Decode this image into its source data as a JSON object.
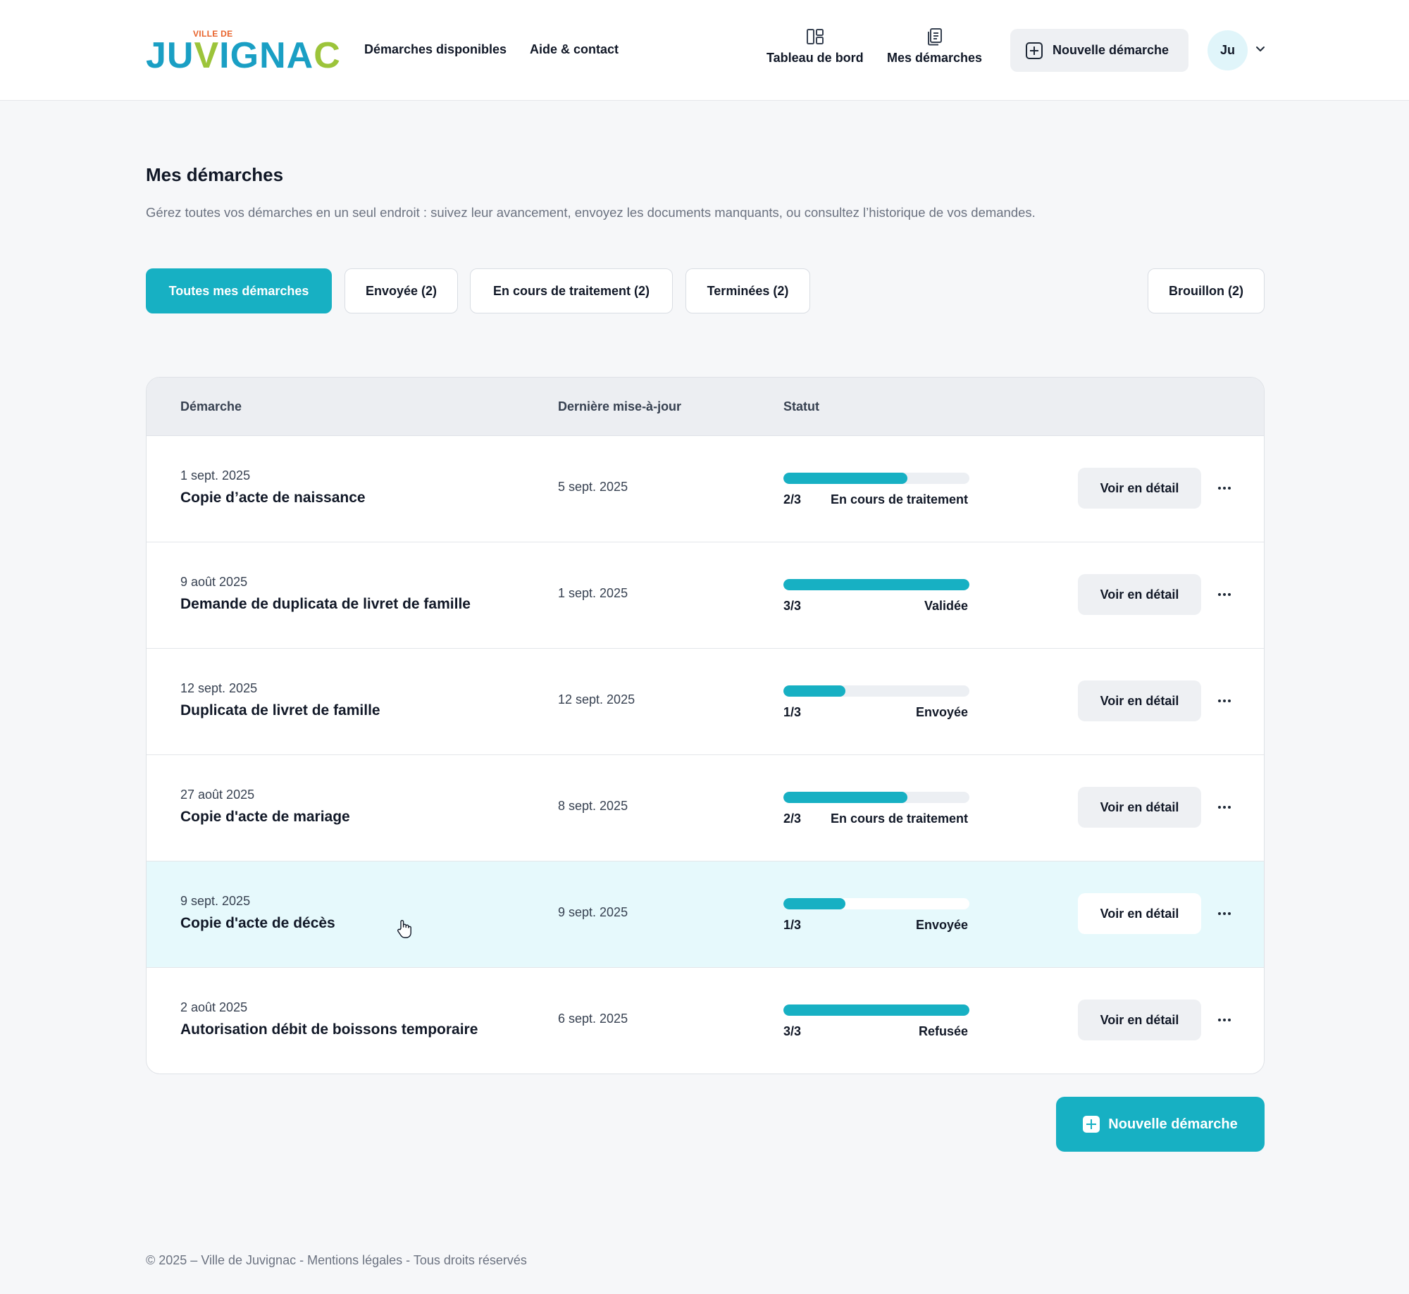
{
  "brand": {
    "small": "VILLE DE",
    "letters": [
      "J",
      "U",
      "V",
      "I",
      "G",
      "N",
      "A",
      "C"
    ],
    "colors": [
      "#1a9fc4",
      "#1a9fc4",
      "#9cc43a",
      "#1a9fc4",
      "#1a9fc4",
      "#1a9fc4",
      "#1a9fc4",
      "#9cc43a"
    ],
    "small_color": "#e8632b"
  },
  "nav": {
    "links": [
      "Démarches disponibles",
      "Aide & contact"
    ],
    "dashboard_label": "Tableau de bord",
    "dashboard_icon": "dashboard-icon",
    "mes_demarches_label": "Mes démarches",
    "mes_demarches_icon": "documents-icon",
    "new_button": "Nouvelle démarche",
    "avatar": "Ju"
  },
  "page": {
    "title": "Mes démarches",
    "subtitle": "Gérez toutes vos démarches en un seul endroit : suivez leur avancement, envoyez les documents manquants, ou consultez l’historique de vos demandes."
  },
  "tabs": [
    {
      "label": "Toutes mes démarches",
      "active": true
    },
    {
      "label": "Envoyée (2)",
      "active": false
    },
    {
      "label": "En cours de traitement (2)",
      "active": false
    },
    {
      "label": "Terminées (2)",
      "active": false
    },
    {
      "label": "Brouillon (2)",
      "active": false
    }
  ],
  "table": {
    "headers": [
      "Démarche",
      "Dernière mise-à-jour",
      "Statut"
    ],
    "detail_label": "Voir en détail",
    "rows": [
      {
        "date": "1 sept. 2025",
        "title": "Copie d’acte de naissance",
        "updated": "5 sept. 2025",
        "step": "2/3",
        "progress": 0.667,
        "status": "En cours de traitement",
        "highlighted": false
      },
      {
        "date": "9 août 2025",
        "title": "Demande de duplicata de livret de famille",
        "updated": "1 sept. 2025",
        "step": "3/3",
        "progress": 1.0,
        "status": "Validée",
        "highlighted": false
      },
      {
        "date": "12 sept. 2025",
        "title": "Duplicata de livret de famille",
        "updated": "12 sept. 2025",
        "step": "1/3",
        "progress": 0.333,
        "status": "Envoyée",
        "highlighted": false
      },
      {
        "date": "27 août 2025",
        "title": "Copie d'acte de mariage",
        "updated": "8 sept. 2025",
        "step": "2/3",
        "progress": 0.667,
        "status": "En cours de traitement",
        "highlighted": false
      },
      {
        "date": "9 sept. 2025",
        "title": "Copie d'acte de décès",
        "updated": "9 sept. 2025",
        "step": "1/3",
        "progress": 0.333,
        "status": "Envoyée",
        "highlighted": true
      },
      {
        "date": "2 août 2025",
        "title": "Autorisation débit de boissons temporaire",
        "updated": "6 sept. 2025",
        "step": "3/3",
        "progress": 1.0,
        "status": "Refusée",
        "highlighted": false
      }
    ]
  },
  "bottom_button": "Nouvelle démarche",
  "footer": "© 2025 – Ville de Juvignac - Mentions légales - Tous droits réservés",
  "colors": {
    "accent": "#17b0c3",
    "highlight_row": "#e6f9fc"
  }
}
